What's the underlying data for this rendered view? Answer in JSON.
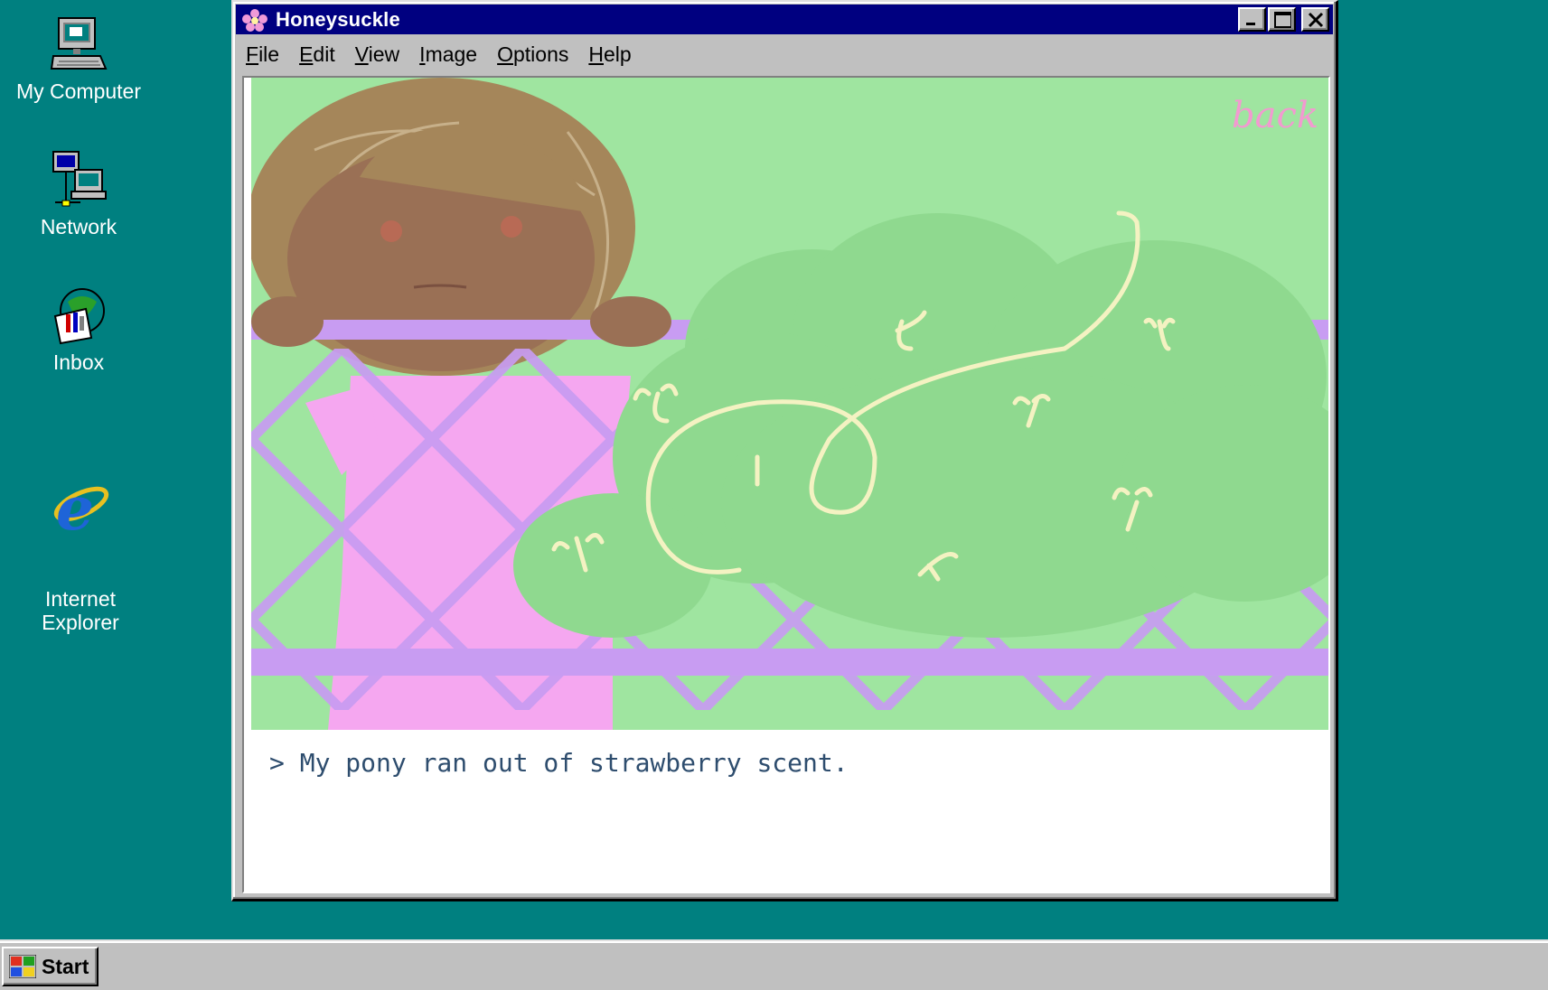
{
  "desktop": {
    "icons": [
      {
        "label": "My Computer",
        "icon": "computer-icon"
      },
      {
        "label": "Network",
        "icon": "network-icon"
      },
      {
        "label": "Inbox",
        "icon": "inbox-icon"
      },
      {
        "label": "Internet\nExplorer",
        "icon": "internet-explorer-icon"
      }
    ]
  },
  "window": {
    "title": "Honeysuckle",
    "menu": [
      "File",
      "Edit",
      "View",
      "Image",
      "Options",
      "Help"
    ],
    "menu_underline": [
      "F",
      "E",
      "V",
      "I",
      "O",
      "H"
    ],
    "scene": {
      "back_link": "back",
      "colors": {
        "grass": "#9fe5a0",
        "fence": "#c89cf2",
        "dress": "#f5a7f0",
        "bush": "#8fd98f",
        "hair": "#a5865a",
        "skin": "#9a7055",
        "vine": "#f4f2c2",
        "back_link": "#f29ad0"
      }
    },
    "console_text": "> My pony ran out of strawberry scent."
  },
  "taskbar": {
    "start_label": "Start"
  },
  "colors": {
    "desktop": "#008080",
    "titlebar": "#000080",
    "chrome": "#c0c0c0",
    "console_text": "#2e4d6e"
  }
}
